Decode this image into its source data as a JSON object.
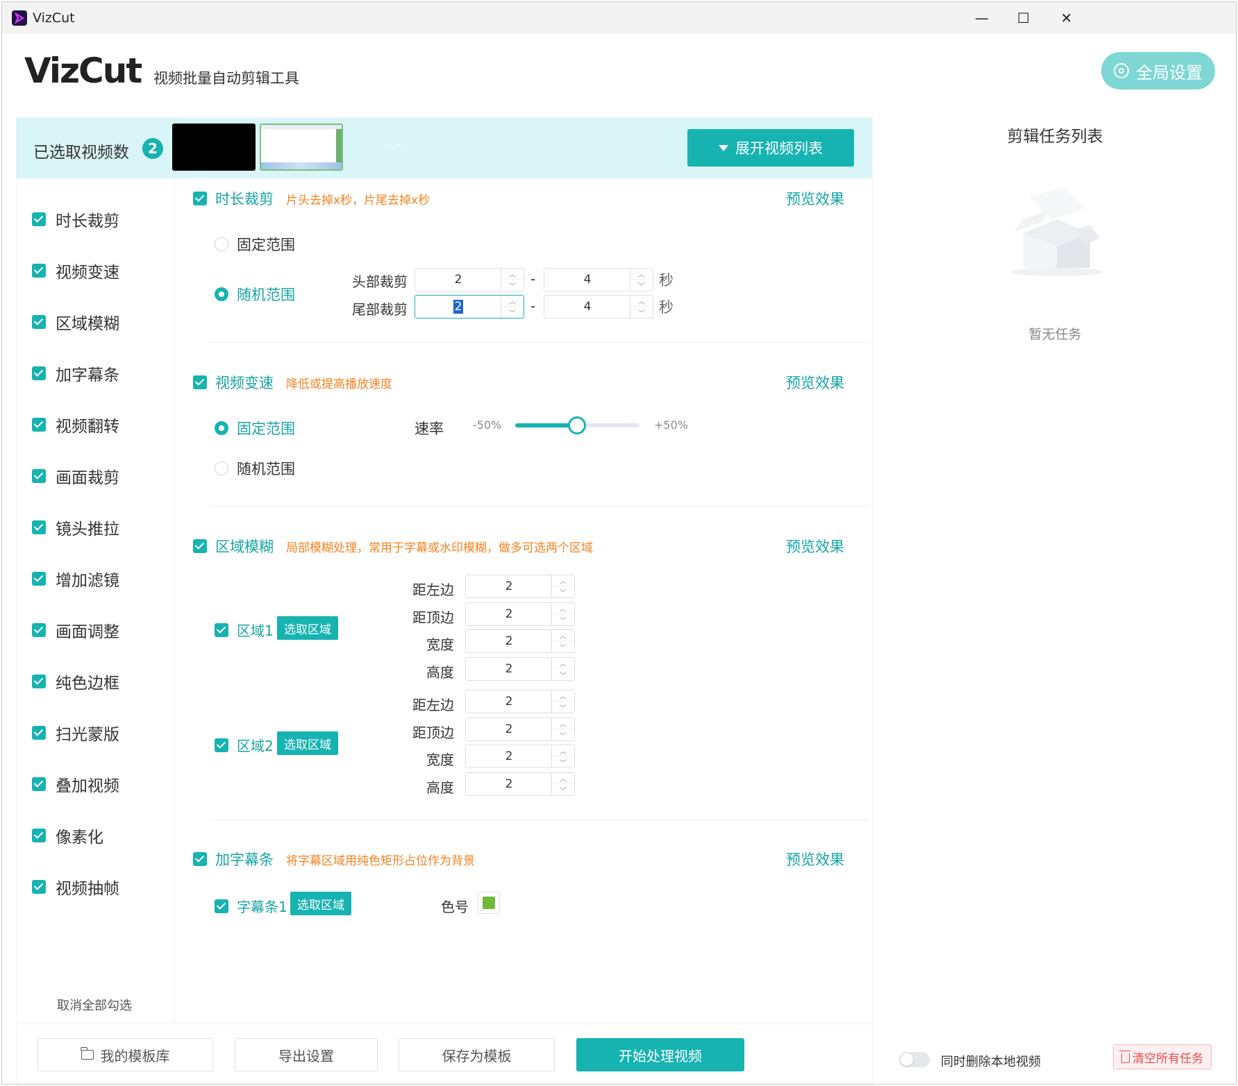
{
  "window": {
    "title": "VizCut",
    "minimize": "—",
    "maximize": "☐",
    "close": "✕"
  },
  "header": {
    "logo": "VizCut",
    "subtitle": "视频批量自动剪辑工具",
    "global_settings": "全局设置"
  },
  "selection": {
    "label": "已选取视频数",
    "count": "2",
    "more": "···",
    "expand_label": "展开视频列表"
  },
  "sidebar": {
    "items": [
      "时长裁剪",
      "视频变速",
      "区域模糊",
      "加字幕条",
      "视频翻转",
      "画面裁剪",
      "镜头推拉",
      "增加滤镜",
      "画面调整",
      "纯色边框",
      "扫光蒙版",
      "叠加视频",
      "像素化",
      "视频抽帧"
    ],
    "cancel_all": "取消全部勾选"
  },
  "sections": {
    "duration": {
      "title": "时长裁剪",
      "hint": "片头去掉x秒，片尾去掉x秒",
      "preview": "预览效果",
      "fixed": "固定范围",
      "random": "随机范围",
      "head_label": "头部裁剪",
      "tail_label": "尾部裁剪",
      "head_min": "2",
      "head_max": "4",
      "tail_min": "2",
      "tail_max": "4",
      "dash": "-",
      "unit": "秒"
    },
    "speed": {
      "title": "视频变速",
      "hint": "降低或提高播放速度",
      "preview": "预览效果",
      "fixed": "固定范围",
      "random": "随机范围",
      "rate_label": "速率",
      "min_label": "-50%",
      "max_label": "+50%",
      "slider_fraction": 0.5
    },
    "blur": {
      "title": "区域模糊",
      "hint": "局部模糊处理，常用于字幕或水印模糊，做多可选两个区域",
      "preview": "预览效果",
      "pick": "选取区域",
      "region1": {
        "label": "区域1",
        "fields": [
          {
            "label": "距左边",
            "value": "2"
          },
          {
            "label": "距顶边",
            "value": "2"
          },
          {
            "label": "宽度",
            "value": "2"
          },
          {
            "label": "高度",
            "value": "2"
          }
        ]
      },
      "region2": {
        "label": "区域2",
        "fields": [
          {
            "label": "距左边",
            "value": "2"
          },
          {
            "label": "距顶边",
            "value": "2"
          },
          {
            "label": "宽度",
            "value": "2"
          },
          {
            "label": "高度",
            "value": "2"
          }
        ]
      }
    },
    "subtitle_bar": {
      "title": "加字幕条",
      "hint": "将字幕区域用纯色矩形占位作为背景",
      "preview": "预览效果",
      "bar1": "字幕条1",
      "pick": "选取区域",
      "color_label": "色号",
      "color": "#6fba3b"
    }
  },
  "footer": {
    "templates": "我的模板库",
    "export": "导出设置",
    "save_template": "保存为模板",
    "start": "开始处理视频"
  },
  "right": {
    "title": "剪辑任务列表",
    "empty": "暂无任务",
    "delete_local": "同时删除本地视频",
    "clear_all": "清空所有任务"
  },
  "colors": {
    "accent": "#16b3b1",
    "hint": "#f58220",
    "danger": "#e84c4c"
  }
}
